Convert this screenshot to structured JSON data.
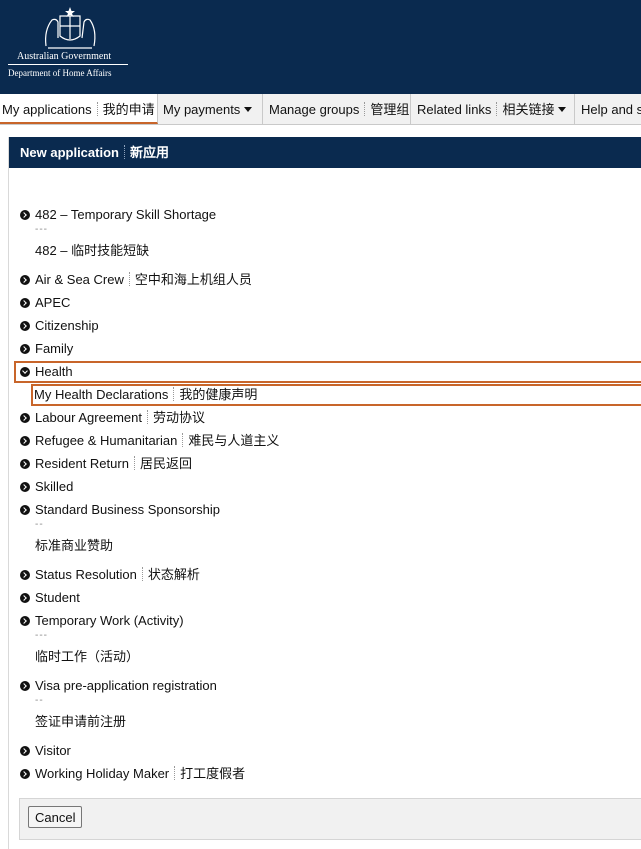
{
  "header": {
    "gov_line1": "Australian Government",
    "gov_line2": "Department of Home Affairs"
  },
  "nav": {
    "my_applications": "My applications",
    "my_applications_cn": "我的申请",
    "my_payments": "My payments",
    "manage_groups": "Manage groups",
    "manage_groups_cn": "管理组",
    "related_links": "Related links",
    "related_links_cn": "相关链接",
    "help": "Help and s"
  },
  "panel": {
    "title": "New application",
    "title_cn": "新应用"
  },
  "categories": [
    {
      "label": "482 – Temporary Skill Shortage",
      "dashes": "---",
      "label_cn": "482 – 临时技能短缺"
    },
    {
      "label": "Air & Sea Crew",
      "label_cn": "空中和海上机组人员"
    },
    {
      "label": "APEC"
    },
    {
      "label": "Citizenship"
    },
    {
      "label": "Family"
    },
    {
      "label": "Health",
      "expanded": true
    },
    {
      "label": "Labour Agreement",
      "label_cn": "劳动协议"
    },
    {
      "label": "Refugee & Humanitarian",
      "label_cn": "难民与人道主义"
    },
    {
      "label": "Resident Return",
      "label_cn": "居民返回"
    },
    {
      "label": "Skilled"
    },
    {
      "label": "Standard Business Sponsorship",
      "dashes": "--",
      "label_cn": "标准商业赞助"
    },
    {
      "label": "Status Resolution",
      "label_cn": "状态解析"
    },
    {
      "label": "Student"
    },
    {
      "label": "Temporary Work (Activity)",
      "dashes": "---",
      "label_cn": "临时工作（活动）"
    },
    {
      "label": "Visa pre-application registration",
      "dashes": "--",
      "label_cn": "签证申请前注册"
    },
    {
      "label": "Visitor"
    },
    {
      "label": "Working Holiday Maker",
      "label_cn": "打工度假者"
    }
  ],
  "health_sub": {
    "label": "My Health Declarations",
    "label_cn": "我的健康声明"
  },
  "footer": {
    "cancel": "Cancel"
  },
  "colors": {
    "header_bg": "#0a2a4f",
    "accent": "#c8652a"
  }
}
